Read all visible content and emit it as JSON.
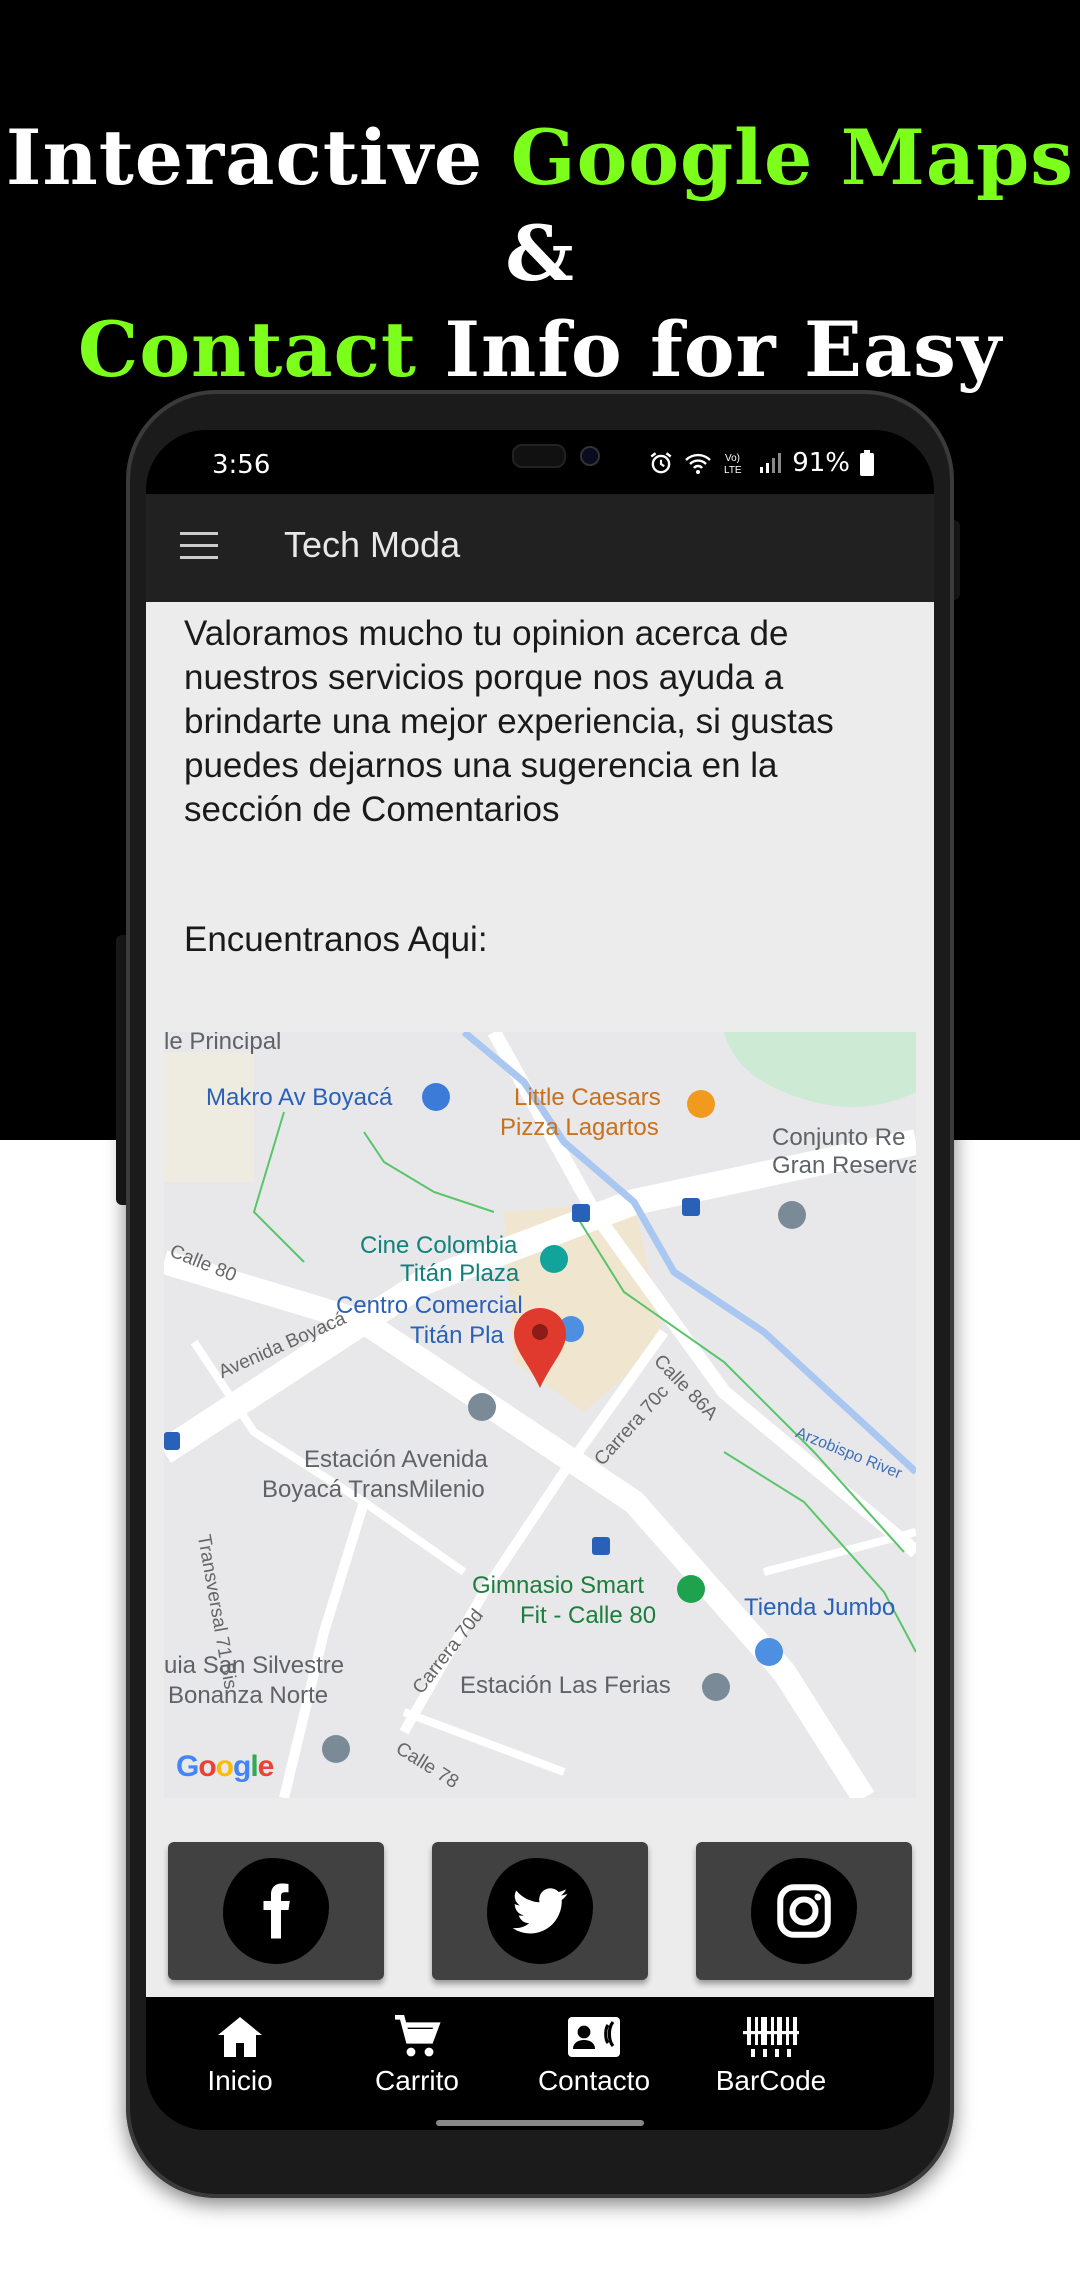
{
  "headline": {
    "line1_a": "Interactive ",
    "line1_b": "Google Maps",
    "line1_c": " &",
    "line2_a": "Contact",
    "line2_b": " Info for Easy Reach"
  },
  "colors": {
    "accent_green": "#7cff1a",
    "appbar": "#212121",
    "content_bg": "#ececec",
    "social_button": "#414141"
  },
  "status_bar": {
    "time": "3:56",
    "battery": "91%",
    "icons": [
      "alarm-icon",
      "wifi-icon",
      "volte-icon",
      "signal-icon",
      "battery-icon"
    ]
  },
  "app_bar": {
    "title": "Tech Moda",
    "menu_icon": "hamburger-menu-icon"
  },
  "content": {
    "paragraph": "Valoramos mucho tu opinion acerca de nuestros servicios porque nos ayuda a brindarte una mejor experiencia, si gustas puedes dejarnos una sugerencia en la sección de Comentarios",
    "find_us": "Encuentranos Aqui:"
  },
  "map": {
    "labels": {
      "principal": "le Principal",
      "makro": "Makro Av Boyacá",
      "little_caesars_1": "Little Caesars",
      "little_caesars_2": "Pizza Lagartos",
      "conjunto_1": "Conjunto Re",
      "conjunto_2": "Gran Reserva",
      "calle80": "Calle 80",
      "cine_1": "Cine Colombia",
      "cine_2": "Titán Plaza",
      "avenida_boyaca": "Avenida Boyacá",
      "centro_1": "Centro Comercial",
      "centro_2": "Titán Pla",
      "calle86a": "Calle 86A",
      "carrera70c": "Carrera 70c",
      "arzobispo": "Arzobispo River",
      "estacion_1": "Estación Avenida",
      "estacion_2": "Boyacá TransMilenio",
      "transversal": "Transversal 71 Bis",
      "gimnasio_1": "Gimnasio Smart",
      "gimnasio_2": "Fit - Calle 80",
      "tienda": "Tienda Jumbo",
      "carrera70d": "Carrera 70d",
      "silvestre_1": "uia San Silvestre",
      "silvestre_2": "Bonanza Norte",
      "ferias": "Estación Las Ferias",
      "calle78": "Calle 78"
    },
    "attribution": "Google"
  },
  "social": [
    {
      "name": "facebook",
      "icon": "facebook-icon"
    },
    {
      "name": "twitter",
      "icon": "twitter-icon"
    },
    {
      "name": "instagram",
      "icon": "instagram-icon"
    }
  ],
  "bottom_nav": [
    {
      "label": "Inicio",
      "icon": "home-icon"
    },
    {
      "label": "Carrito",
      "icon": "cart-icon"
    },
    {
      "label": "Contacto",
      "icon": "contact-card-icon"
    },
    {
      "label": "BarCode",
      "icon": "barcode-icon"
    }
  ]
}
